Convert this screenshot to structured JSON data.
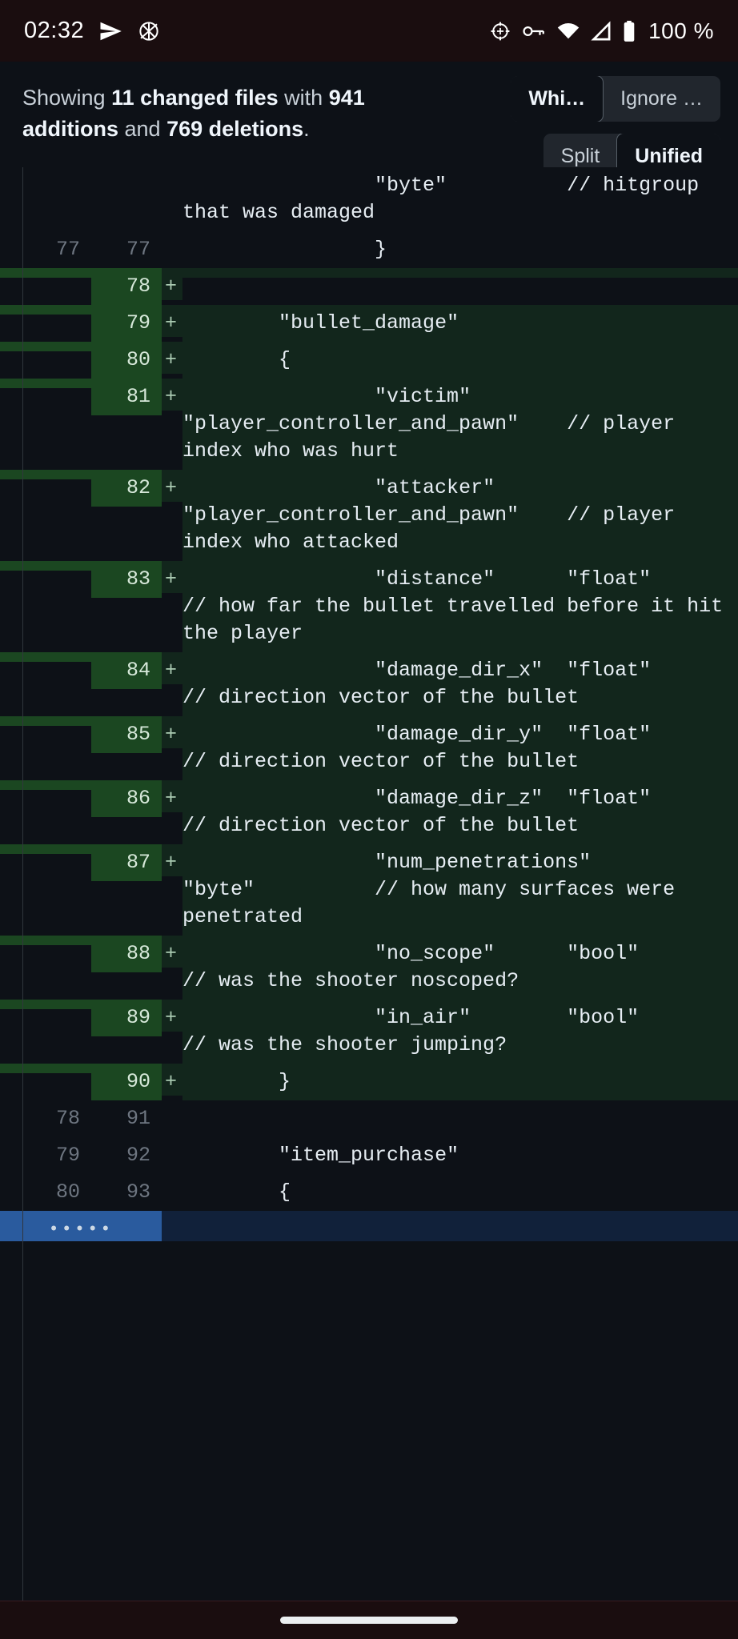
{
  "statusbar": {
    "time": "02:32",
    "battery_percent": "100 %",
    "icons": [
      "send-icon",
      "anarchy-icon",
      "location-crosshair-icon",
      "vpn-key-icon",
      "wifi-icon",
      "signal-icon",
      "battery-icon"
    ]
  },
  "header": {
    "summary_prefix": "Showing ",
    "summary_files": "11 changed files",
    "summary_with": " with ",
    "summary_additions": "941 additions",
    "summary_and": " and ",
    "summary_deletions": "769 deletions",
    "summary_suffix": ".",
    "whitespace_toggle": {
      "active": "Whi…",
      "inactive": "Ignore …"
    },
    "viewmode_toggle": {
      "inactive": "Split",
      "active": "Unified"
    }
  },
  "diff": {
    "rows": [
      {
        "type": "ctx",
        "old": "",
        "new": "",
        "marker": "",
        "code": "                \"byte\"          // hitgroup that was damaged"
      },
      {
        "type": "ctx",
        "old": "77",
        "new": "77",
        "marker": "",
        "code": "                }"
      },
      {
        "type": "add",
        "old": "",
        "new": "78",
        "marker": "+",
        "code": ""
      },
      {
        "type": "add",
        "old": "",
        "new": "79",
        "marker": "+",
        "code": "        \"bullet_damage\""
      },
      {
        "type": "add",
        "old": "",
        "new": "80",
        "marker": "+",
        "code": "        {"
      },
      {
        "type": "add",
        "old": "",
        "new": "81",
        "marker": "+",
        "code": "                \"victim\"        \"player_controller_and_pawn\"    // player index who was hurt"
      },
      {
        "type": "add",
        "old": "",
        "new": "82",
        "marker": "+",
        "code": "                \"attacker\"      \"player_controller_and_pawn\"    // player index who attacked"
      },
      {
        "type": "add",
        "old": "",
        "new": "83",
        "marker": "+",
        "code": "                \"distance\"      \"float\"         // how far the bullet travelled before it hit the player"
      },
      {
        "type": "add",
        "old": "",
        "new": "84",
        "marker": "+",
        "code": "                \"damage_dir_x\"  \"float\"         // direction vector of the bullet"
      },
      {
        "type": "add",
        "old": "",
        "new": "85",
        "marker": "+",
        "code": "                \"damage_dir_y\"  \"float\"         // direction vector of the bullet"
      },
      {
        "type": "add",
        "old": "",
        "new": "86",
        "marker": "+",
        "code": "                \"damage_dir_z\"  \"float\"         // direction vector of the bullet"
      },
      {
        "type": "add",
        "old": "",
        "new": "87",
        "marker": "+",
        "code": "                \"num_penetrations\"      \"byte\"          // how many surfaces were penetrated"
      },
      {
        "type": "add",
        "old": "",
        "new": "88",
        "marker": "+",
        "code": "                \"no_scope\"      \"bool\"          // was the shooter noscoped?"
      },
      {
        "type": "add",
        "old": "",
        "new": "89",
        "marker": "+",
        "code": "                \"in_air\"        \"bool\"          // was the shooter jumping?"
      },
      {
        "type": "add",
        "old": "",
        "new": "90",
        "marker": "+",
        "code": "        }"
      },
      {
        "type": "ctx",
        "old": "78",
        "new": "91",
        "marker": "",
        "code": ""
      },
      {
        "type": "ctx",
        "old": "79",
        "new": "92",
        "marker": "",
        "code": "        \"item_purchase\""
      },
      {
        "type": "ctx",
        "old": "80",
        "new": "93",
        "marker": "",
        "code": "        {"
      }
    ],
    "expander_label": "•••••"
  },
  "colors": {
    "background": "#0d1117",
    "addition_gutter": "#1b4721",
    "addition_body": "#12261c",
    "expander": "#2a5b9e",
    "statusbar": "#1a0d0f"
  }
}
